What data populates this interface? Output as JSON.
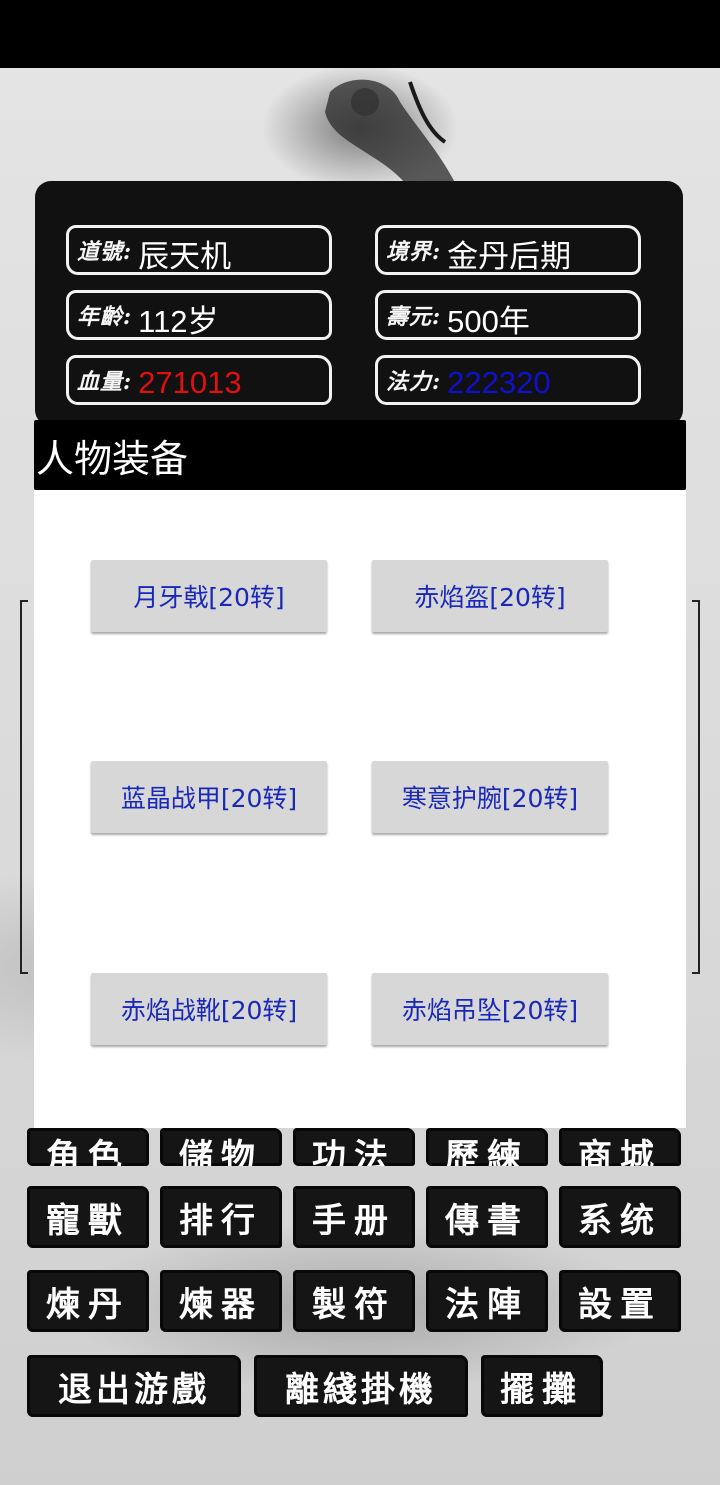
{
  "stats": {
    "daohao": {
      "label": "道號:",
      "value": "辰天机"
    },
    "jingjie": {
      "label": "境界:",
      "value": "金丹后期"
    },
    "nianling": {
      "label": "年齡:",
      "value": "112岁"
    },
    "shouyuan": {
      "label": "壽元:",
      "value": "500年"
    },
    "xueliang": {
      "label": "血量:",
      "value": "271013"
    },
    "fali": {
      "label": "法力:",
      "value": "222320"
    }
  },
  "dialog": {
    "title": "人物装备",
    "items": [
      "月牙戟[20转]",
      "赤焰盔[20转]",
      "蓝晶战甲[20转]",
      "寒意护腕[20转]",
      "赤焰战靴[20转]",
      "赤焰吊坠[20转]"
    ]
  },
  "menu": {
    "row1": [
      "角色",
      "儲物",
      "功法",
      "歷練",
      "商城"
    ],
    "row2": [
      "寵獸",
      "排行",
      "手册",
      "傳書",
      "系统"
    ],
    "row3": [
      "煉丹",
      "煉器",
      "製符",
      "法陣",
      "設置"
    ],
    "row4": [
      "退出游戲",
      "離綫掛機",
      "擺攤"
    ]
  },
  "colors": {
    "hp": "#e01010",
    "mp": "#1010d0",
    "equip_text": "#1a28b8"
  }
}
